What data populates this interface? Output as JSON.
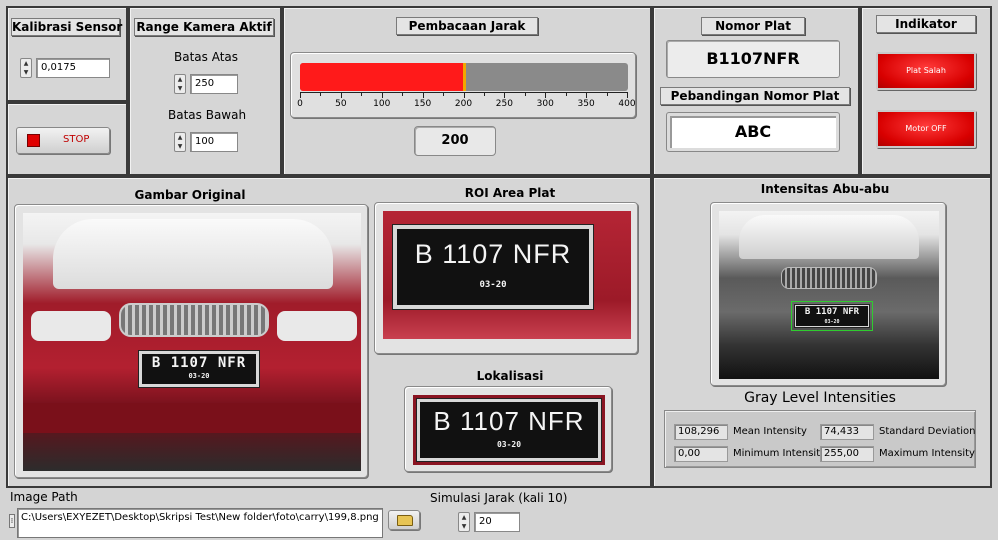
{
  "kalibrasi": {
    "title": "Kalibrasi Sensor",
    "value": "0,0175"
  },
  "stop": {
    "label": "STOP"
  },
  "range": {
    "title": "Range Kamera Aktif",
    "atas_label": "Batas Atas",
    "atas_value": "250",
    "bawah_label": "Batas Bawah",
    "bawah_value": "100"
  },
  "jarak": {
    "title": "Pembacaan Jarak",
    "value": "200",
    "fill_value": 200,
    "max": 400,
    "ticks": [
      "0",
      "50",
      "100",
      "150",
      "200",
      "250",
      "300",
      "350",
      "400"
    ],
    "colors": {
      "fill": "#ff1a1a",
      "track": "#8a8a8a",
      "marker": "#f2a800"
    }
  },
  "plat": {
    "title": "Nomor Plat",
    "value": "B1107NFR",
    "compare_title": "Pebandingan Nomor Plat",
    "compare_value": "ABC"
  },
  "indikator": {
    "title": "Indikator",
    "led1": "Plat Salah",
    "led2": "Motor OFF",
    "color": "#e60000"
  },
  "images": {
    "original_title": "Gambar Original",
    "roi_title": "ROI Area Plat",
    "lokalisasi_title": "Lokalisasi",
    "intensitas_title": "Intensitas Abu-abu",
    "plate_main": "B  1107 NFR",
    "plate_sub": "03-20"
  },
  "gray": {
    "title": "Gray Level Intensities",
    "mean_label": "Mean Intensity",
    "mean_value": "108,296",
    "std_label": "Standard  Deviation",
    "std_value": "74,433",
    "min_label": "Minimum Intensity",
    "min_value": "0,00",
    "max_label": "Maximum Intensity",
    "max_value": "255,00"
  },
  "path": {
    "label": "Image Path",
    "value": "C:\\Users\\EXYEZET\\Desktop\\Skripsi Test\\New folder\\foto\\carry\\199,8.png"
  },
  "simulasi": {
    "label": "Simulasi Jarak (kali 10)",
    "value": "20"
  }
}
